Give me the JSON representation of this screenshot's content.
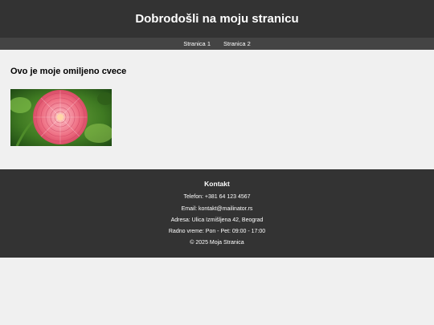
{
  "header": {
    "title": "Dobrodošli na moju stranicu"
  },
  "nav": {
    "links": [
      "Stranica 1",
      "Stranica 2"
    ]
  },
  "main": {
    "heading": "Ovo je moje omiljeno cvece"
  },
  "footer": {
    "heading": "Kontakt",
    "phone": "Telefon: +381 64 123 4567",
    "email": "Email: kontakt@mailinator.rs",
    "address": "Adresa: Ulica Izmišljena 42, Beograd",
    "hours": "Radno vreme: Pon - Pet: 09:00 - 17:00",
    "copyright": "© 2025 Moja Stranica"
  },
  "colors": {
    "header_bg": "#333333",
    "nav_bg": "#444444",
    "page_bg": "#f0f0f0",
    "footer_bg": "#333333",
    "flower_pink": "#f07a8c"
  }
}
